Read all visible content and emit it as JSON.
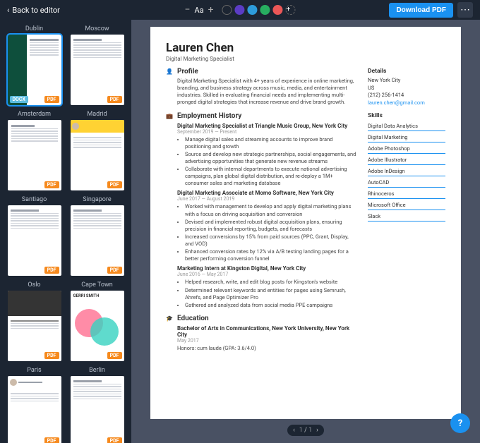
{
  "topbar": {
    "back": "Back to editor",
    "zoom_label": "Aa",
    "download": "Download PDF",
    "colors": [
      "#5b3cc4",
      "#2d9cdb",
      "#27ae60",
      "#eb5757"
    ]
  },
  "templates": [
    {
      "label": "Dublin",
      "badges": [
        "PDF",
        "DOCX"
      ],
      "kind": "dublin",
      "selected": true
    },
    {
      "label": "Moscow",
      "badges": [
        "PDF"
      ],
      "kind": "lines"
    },
    {
      "label": "Amsterdam",
      "badges": [
        "PDF"
      ],
      "kind": "amst"
    },
    {
      "label": "Madrid",
      "badges": [
        "PDF"
      ],
      "kind": "madrid"
    },
    {
      "label": "Santiago",
      "badges": [
        "PDF"
      ],
      "kind": "lines"
    },
    {
      "label": "Singapore",
      "badges": [
        "PDF"
      ],
      "kind": "lines"
    },
    {
      "label": "Oslo",
      "badges": [
        "PDF"
      ],
      "kind": "oslo"
    },
    {
      "label": "Cape Town",
      "badges": [
        "PDF"
      ],
      "kind": "cape"
    },
    {
      "label": "Paris",
      "badges": [
        "PDF"
      ],
      "kind": "paris"
    },
    {
      "label": "Berlin",
      "badges": [
        "PDF"
      ],
      "kind": "lines"
    }
  ],
  "resume": {
    "name": "Lauren Chen",
    "role": "Digital Marketing Specialist",
    "profile_title": "Profile",
    "profile": "Digital Marketing Specialist with 4+ years of experience in online marketing, branding, and business strategy across music, media, and entertainment industries. Skilled in evaluating financial needs and implementing multi-pronged digital strategies that increase revenue and drive brand growth.",
    "emp_title": "Employment History",
    "jobs": [
      {
        "title": "Digital Marketing Specialist at Triangle Music Group, New York City",
        "dates": "September 2019 — Present",
        "bullets": [
          "Manage digital sales and streaming accounts to improve brand positioning and growth",
          "Source and develop new strategic partnerships, social engagements, and advertising opportunities that generate new revenue streams",
          "Collaborate with internal departments to execute national advertising campaigns, plan global digital distribution, and re-deploy a 1M+ consumer sales and marketing database"
        ]
      },
      {
        "title": "Digital Marketing Associate at Momo Software, New York City",
        "dates": "June 2017 — August 2019",
        "bullets": [
          "Worked with management to develop and apply digital marketing plans with a focus on driving acquisition and conversion",
          "Devised and implemented robust digital acquisition plans, ensuring precision in financial reporting, budgets, and forecasts",
          "Increased conversions by 15% from paid sources (PPC, Grant, Display, and VOD)",
          "Enhanced conversion rates by 12% via A/B testing landing pages for a better performing conversion funnel"
        ]
      },
      {
        "title": "Marketing Intern at Kingston Digital, New York City",
        "dates": "June 2016 — May 2017",
        "bullets": [
          "Helped research, write, and edit blog posts for Kingston's website",
          "Determined relevant keywords and entities for pages using Semrush, Ahrefs, and Page Optimizer Pro",
          "Gathered and analyzed data from social media PPE campaigns"
        ]
      }
    ],
    "edu_title": "Education",
    "edu": {
      "title": "Bachelor of Arts in Communications, New York University, New York City",
      "dates": "May 2017",
      "note": "Honors: cum laude (GPA: 3.6/4.0)"
    },
    "details_title": "Details",
    "details": {
      "city": "New York City",
      "country": "US",
      "phone": "(212) 256-1414",
      "email": "lauren.chen@gmail.com"
    },
    "skills_title": "Skills",
    "skills": [
      "Digital Data Analytics",
      "Digital Marketing",
      "Adobe Photoshop",
      "Adobe Illustrator",
      "Adobe InDesign",
      "AutoCAD",
      "Rhinoceros",
      "Microsoft Office",
      "Slack"
    ]
  },
  "pager": {
    "current": 1,
    "total": 1
  }
}
